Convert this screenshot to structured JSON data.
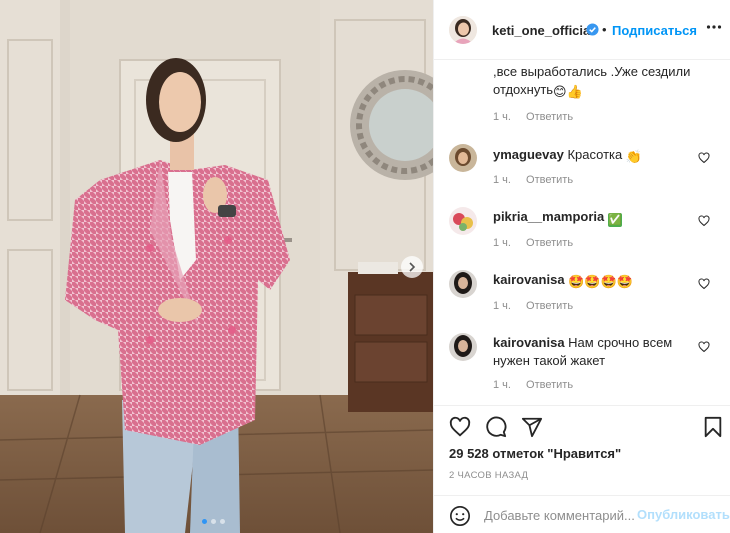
{
  "post": {
    "username": "keti_one_official",
    "follow_label": "Подписаться",
    "bullet": "•",
    "icons": {
      "verified": "verified-badge-icon",
      "more": "more-options-icon"
    },
    "colors": {
      "accent": "#0095f6",
      "text": "#262626",
      "muted": "#8e8e8e",
      "publish_disabled": "#b2dffc"
    }
  },
  "comments": [
    {
      "text_line1": ",все выработались .Уже сездили",
      "text_line2": "отдохнуть",
      "emoji": [
        "😊",
        "👍"
      ],
      "time": "1 ч.",
      "reply": "Ответить"
    },
    {
      "user": "ymaguevay",
      "text": "Красотка",
      "emoji": "👏",
      "time": "1 ч.",
      "reply": "Ответить"
    },
    {
      "user": "pikria__mamporia",
      "text": "",
      "emoji": "✅",
      "time": "1 ч.",
      "reply": "Ответить"
    },
    {
      "user": "kairovanisa",
      "text": "",
      "emoji": "🤩🤩🤩🤩",
      "time": "1 ч.",
      "reply": "Ответить"
    },
    {
      "user": "kairovanisa",
      "text_line1": "Нам срочно всем",
      "text_line2": "нужен такой жакет",
      "time": "1 ч.",
      "reply": "Ответить"
    }
  ],
  "footer": {
    "likes": "29 528 отметок \"Нравится\"",
    "timestamp": "2 ЧАСОВ НАЗАД",
    "comment_placeholder": "Добавьте комментарий...",
    "publish_label": "Опубликовать",
    "icons": [
      "heart-icon",
      "comment-icon",
      "share-icon",
      "bookmark-icon",
      "smiley-icon"
    ]
  },
  "carousel": {
    "total_slides": 3,
    "active_slide": 1
  }
}
